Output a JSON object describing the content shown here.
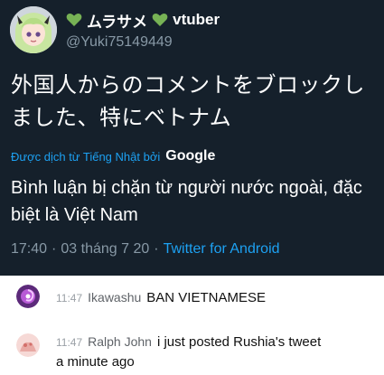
{
  "tweet": {
    "display_name": "ムラサメ",
    "display_suffix": "vtuber",
    "handle": "@Yuki75149449",
    "original_text": "外国人からのコメントをブロックしました、特にベトナム",
    "translated_by_label": "Được dịch từ Tiếng Nhật bởi",
    "translated_by_brand": "Google",
    "translated_text": "Bình luận bị chặn từ người nước ngoài, đặc biệt là Việt Nam",
    "time": "17:40",
    "date": "03 tháng 7 20",
    "source": "Twitter for Android",
    "separator": "·",
    "colors": {
      "background": "#15202b",
      "link": "#1da1f2",
      "muted": "#8899a6",
      "heart": "#77b255"
    }
  },
  "comments": [
    {
      "time": "11:47",
      "user": "Ikawashu",
      "text": "BAN VIETNAMESE",
      "avatar_icon": "purple-swirl-avatar"
    },
    {
      "time": "11:47",
      "user": "Ralph John",
      "text": "i just posted Rushia's tweet",
      "text_continued": "a minute ago",
      "avatar_icon": "pink-illustration-avatar"
    }
  ]
}
